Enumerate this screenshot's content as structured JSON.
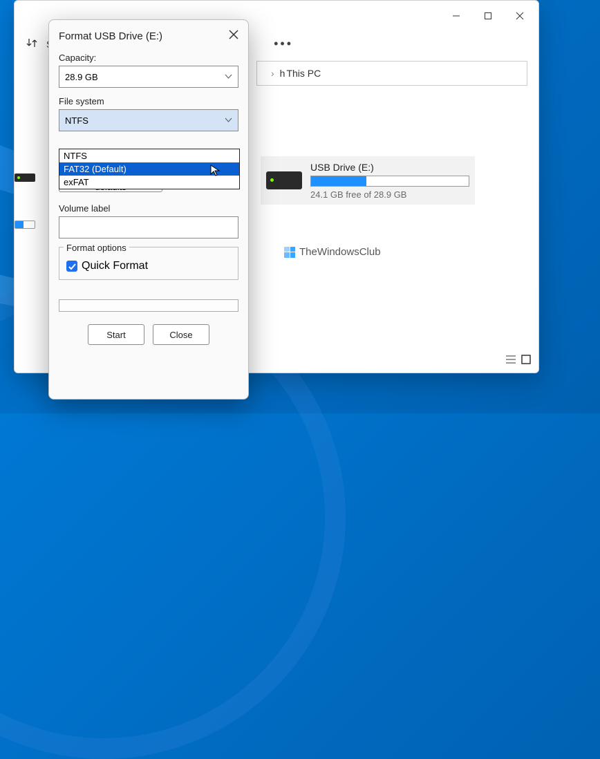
{
  "explorer": {
    "toolbar_sort": "So",
    "addr_prefix": "h",
    "addr_text": "This PC",
    "drive": {
      "title": "USB Drive (E:)",
      "free": "24.1 GB free of 28.9 GB"
    },
    "watermark": "TheWindowsClub"
  },
  "dialog": {
    "title": "Format USB Drive (E:)",
    "capacity_label": "Capacity:",
    "capacity_value": "28.9 GB",
    "filesystem_label": "File system",
    "filesystem_value": "NTFS",
    "fs_options": {
      "opt0": "NTFS",
      "opt1": "FAT32 (Default)",
      "opt2": "exFAT"
    },
    "restore_btn": "Restore device defaults",
    "volume_label": "Volume label",
    "volume_value": "",
    "format_options_label": "Format options",
    "quick_format": "Quick Format",
    "start_btn": "Start",
    "close_btn": "Close"
  }
}
